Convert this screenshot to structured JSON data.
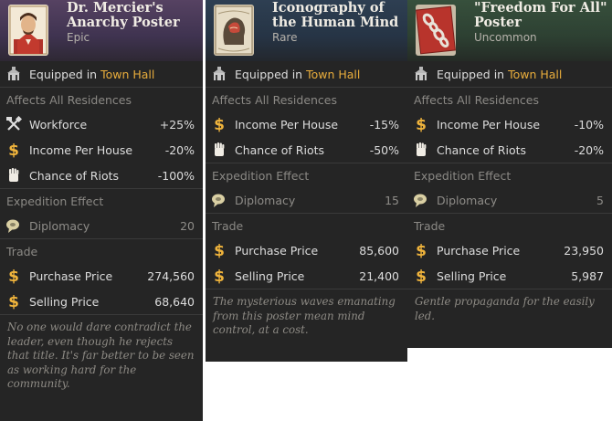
{
  "cards": [
    {
      "title": "Dr. Mercier's Anarchy Poster",
      "rarity": "Epic",
      "portrait_icon": "portrait-poster-icon",
      "equipped": {
        "label": "Equipped in",
        "location": "Town Hall"
      },
      "affects_label": "Affects All Residences",
      "effects": [
        {
          "icon": "workforce-icon",
          "name": "Workforce",
          "value": "+25%"
        },
        {
          "icon": "income-icon",
          "name": "Income Per House",
          "value": "-20%"
        },
        {
          "icon": "riots-icon",
          "name": "Chance of Riots",
          "value": "-100%"
        }
      ],
      "expedition_label": "Expedition Effect",
      "expedition": [
        {
          "icon": "diplomacy-icon",
          "name": "Diplomacy",
          "value": "20"
        }
      ],
      "trade_label": "Trade",
      "trade": [
        {
          "icon": "income-icon",
          "name": "Purchase Price",
          "value": "274,560"
        },
        {
          "icon": "income-icon",
          "name": "Selling Price",
          "value": "68,640"
        }
      ],
      "description": "No one would dare contradict the leader, even though he rejects that title. It's far better to be seen as working hard for the community."
    },
    {
      "title": "Iconography of the Human Mind",
      "rarity": "Rare",
      "portrait_icon": "brain-poster-icon",
      "equipped": {
        "label": "Equipped in",
        "location": "Town Hall"
      },
      "affects_label": "Affects All Residences",
      "effects": [
        {
          "icon": "income-icon",
          "name": "Income Per House",
          "value": "-15%"
        },
        {
          "icon": "riots-icon",
          "name": "Chance of Riots",
          "value": "-50%"
        }
      ],
      "expedition_label": "Expedition Effect",
      "expedition": [
        {
          "icon": "diplomacy-icon",
          "name": "Diplomacy",
          "value": "15"
        }
      ],
      "trade_label": "Trade",
      "trade": [
        {
          "icon": "income-icon",
          "name": "Purchase Price",
          "value": "85,600"
        },
        {
          "icon": "income-icon",
          "name": "Selling Price",
          "value": "21,400"
        }
      ],
      "description": "The mysterious waves emanating from this poster mean mind control, at a cost."
    },
    {
      "title": "\"Freedom For All\" Poster",
      "rarity": "Uncommon",
      "portrait_icon": "chain-poster-icon",
      "equipped": {
        "label": "Equipped in",
        "location": "Town Hall"
      },
      "affects_label": "Affects All Residences",
      "effects": [
        {
          "icon": "income-icon",
          "name": "Income Per House",
          "value": "-10%"
        },
        {
          "icon": "riots-icon",
          "name": "Chance of Riots",
          "value": "-20%"
        }
      ],
      "expedition_label": "Expedition Effect",
      "expedition": [
        {
          "icon": "diplomacy-icon",
          "name": "Diplomacy",
          "value": "5"
        }
      ],
      "trade_label": "Trade",
      "trade": [
        {
          "icon": "income-icon",
          "name": "Purchase Price",
          "value": "23,950"
        },
        {
          "icon": "income-icon",
          "name": "Selling Price",
          "value": "5,987"
        }
      ],
      "description": "Gentle propaganda for the easily led."
    }
  ],
  "colors": {
    "panel": "#252525",
    "epic_header": "#4a3a56",
    "rare_header": "#2b3a4c",
    "uncommon_header": "#334a38",
    "location": "#e9ad3c",
    "dim_text": "#8b8985"
  }
}
